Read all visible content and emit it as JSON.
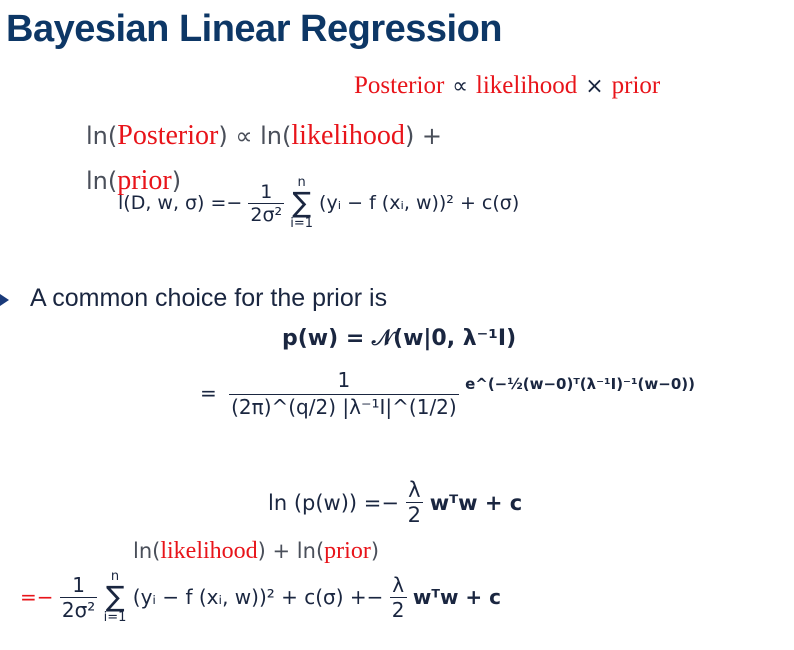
{
  "title": "Bayesian Linear Regression",
  "proportional": {
    "posterior": "Posterior",
    "propto": "∝",
    "likelihood": "likelihood",
    "times": "×",
    "prior": "prior"
  },
  "log_posterior": {
    "ln1": "ln(",
    "posterior": "Posterior",
    "close1": ")",
    "propto": " ∝ ",
    "ln2": "ln(",
    "likelihood": "likelihood",
    "close2": ") +",
    "ln3": "ln(",
    "prior": "prior",
    "close3": ")"
  },
  "log_likelihood_formula": {
    "lhs": "l(D, w, σ) =−",
    "frac_num": "1",
    "frac_den": "2σ²",
    "sum_top": "n",
    "sum_bottom": "i=1",
    "body": "(yᵢ − f (xᵢ, w))² + c(σ)"
  },
  "bullet": "A common choice for the prior is",
  "prior_formula": {
    "line1": "p(w) = 𝒩(w|0, λ⁻¹I)",
    "eq": "=",
    "frac_num": "1",
    "frac_den": "(2π)^(q/2) |λ⁻¹I|^(1/2)",
    "exp": "e^(−½(w−0)ᵀ(λ⁻¹I)⁻¹(w−0))"
  },
  "log_prior_formula": {
    "lhs": "ln (p(w)) =−",
    "frac_num": "λ",
    "frac_den": "2",
    "rhs": "wᵀw + c"
  },
  "log_sum_line": {
    "ln1": "ln(",
    "likelihood": "likelihood",
    "mid": ") + ln(",
    "prior": "prior",
    "close": ")"
  },
  "final_formula": {
    "eq": "=−",
    "frac_num": "1",
    "frac_den": "2σ²",
    "sum_top": "n",
    "sum_bottom": "i=1",
    "body": "(yᵢ − f (xᵢ, w))² + c(σ) +−",
    "frac2_num": "λ",
    "frac2_den": "2",
    "tail": "wᵀw + c"
  }
}
